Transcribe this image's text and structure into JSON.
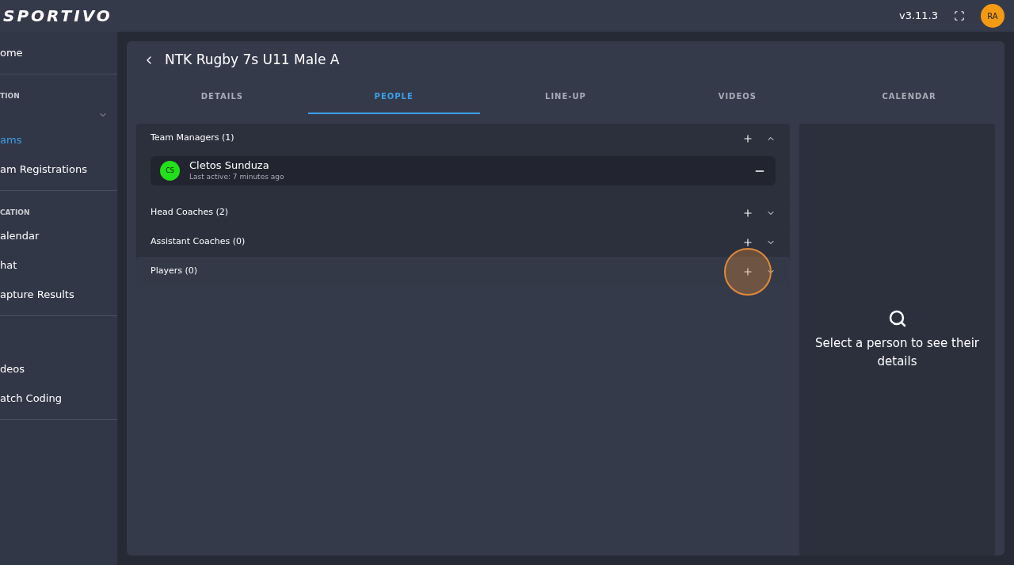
{
  "header": {
    "logo": "SPORTIVO",
    "version": "v3.11.3",
    "avatar": "RA"
  },
  "sidebar": {
    "groups": [
      {
        "items": [
          {
            "kind": "link",
            "label": "ome",
            "selected": false
          }
        ]
      },
      {
        "items": [
          {
            "kind": "heading",
            "label": "TION"
          },
          {
            "kind": "select"
          },
          {
            "kind": "link",
            "label": "ams",
            "selected": true
          },
          {
            "kind": "link",
            "label": "am Registrations",
            "selected": false
          }
        ]
      },
      {
        "items": [
          {
            "kind": "heading",
            "label": "CATION"
          },
          {
            "kind": "link",
            "label": "alendar",
            "selected": false
          },
          {
            "kind": "link",
            "label": "hat",
            "selected": false
          },
          {
            "kind": "link",
            "label": "apture Results",
            "selected": false
          }
        ]
      },
      {
        "items": [
          {
            "kind": "spacer"
          },
          {
            "kind": "link",
            "label": "deos",
            "selected": false
          },
          {
            "kind": "link",
            "label": "atch Coding",
            "selected": false
          }
        ]
      }
    ]
  },
  "page": {
    "title": "NTK Rugby 7s U11 Male A"
  },
  "tabs": [
    {
      "label": "DETAILS",
      "selected": false
    },
    {
      "label": "PEOPLE",
      "selected": true
    },
    {
      "label": "LINE-UP",
      "selected": false
    },
    {
      "label": "VIDEOS",
      "selected": false
    },
    {
      "label": "CALENDAR",
      "selected": false
    }
  ],
  "sections": [
    {
      "title": "Team Managers (1)",
      "expanded": true,
      "highlighted": false,
      "people": [
        {
          "initials": "CS",
          "name": "Cletos Sunduza",
          "last_active": "Last active: 7 minutes ago",
          "color": "#22e01a"
        }
      ]
    },
    {
      "title": "Head Coaches (2)",
      "expanded": false,
      "highlighted": false
    },
    {
      "title": "Assistant Coaches (0)",
      "expanded": false,
      "highlighted": false
    },
    {
      "title": "Players (0)",
      "expanded": false,
      "highlighted": true
    }
  ],
  "detail_panel": {
    "message": "Select a person to see their details"
  }
}
